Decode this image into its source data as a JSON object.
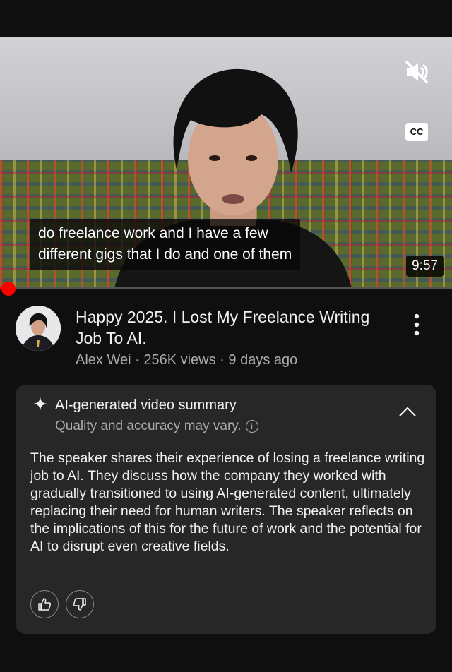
{
  "video": {
    "caption_lines": [
      "do freelance work and I have a few",
      "different gigs that I do and one of them"
    ],
    "duration": "9:57",
    "progress_fraction": 0.015,
    "icons": {
      "mute": "volume-off-icon",
      "captions": "cc-icon"
    },
    "cc_label": "CC"
  },
  "video_info": {
    "title": "Happy 2025. I Lost My Freelance Writing Job To AI.",
    "channel": "Alex Wei",
    "views": "256K views",
    "age": "9 days ago",
    "separator": "·"
  },
  "summary": {
    "heading": "AI-generated video summary",
    "note": "Quality and accuracy may vary.",
    "body": "The speaker shares their experience of losing a freelance writing job to AI. They discuss how the company they worked with gradually transitioned to using AI-generated content, ultimately replacing their need for human writers. The speaker reflects on the implications of this for the future of work and the potential for AI to disrupt even creative fields.",
    "info_glyph": "i",
    "icons": {
      "sparkle": "sparkle-icon",
      "collapse": "chevron-up-icon",
      "like": "thumbs-up-icon",
      "dislike": "thumbs-down-icon"
    }
  },
  "colors": {
    "accent": "#ff0000",
    "background": "#0f0f0f",
    "card": "#272727",
    "muted_text": "#aaaaaa"
  }
}
